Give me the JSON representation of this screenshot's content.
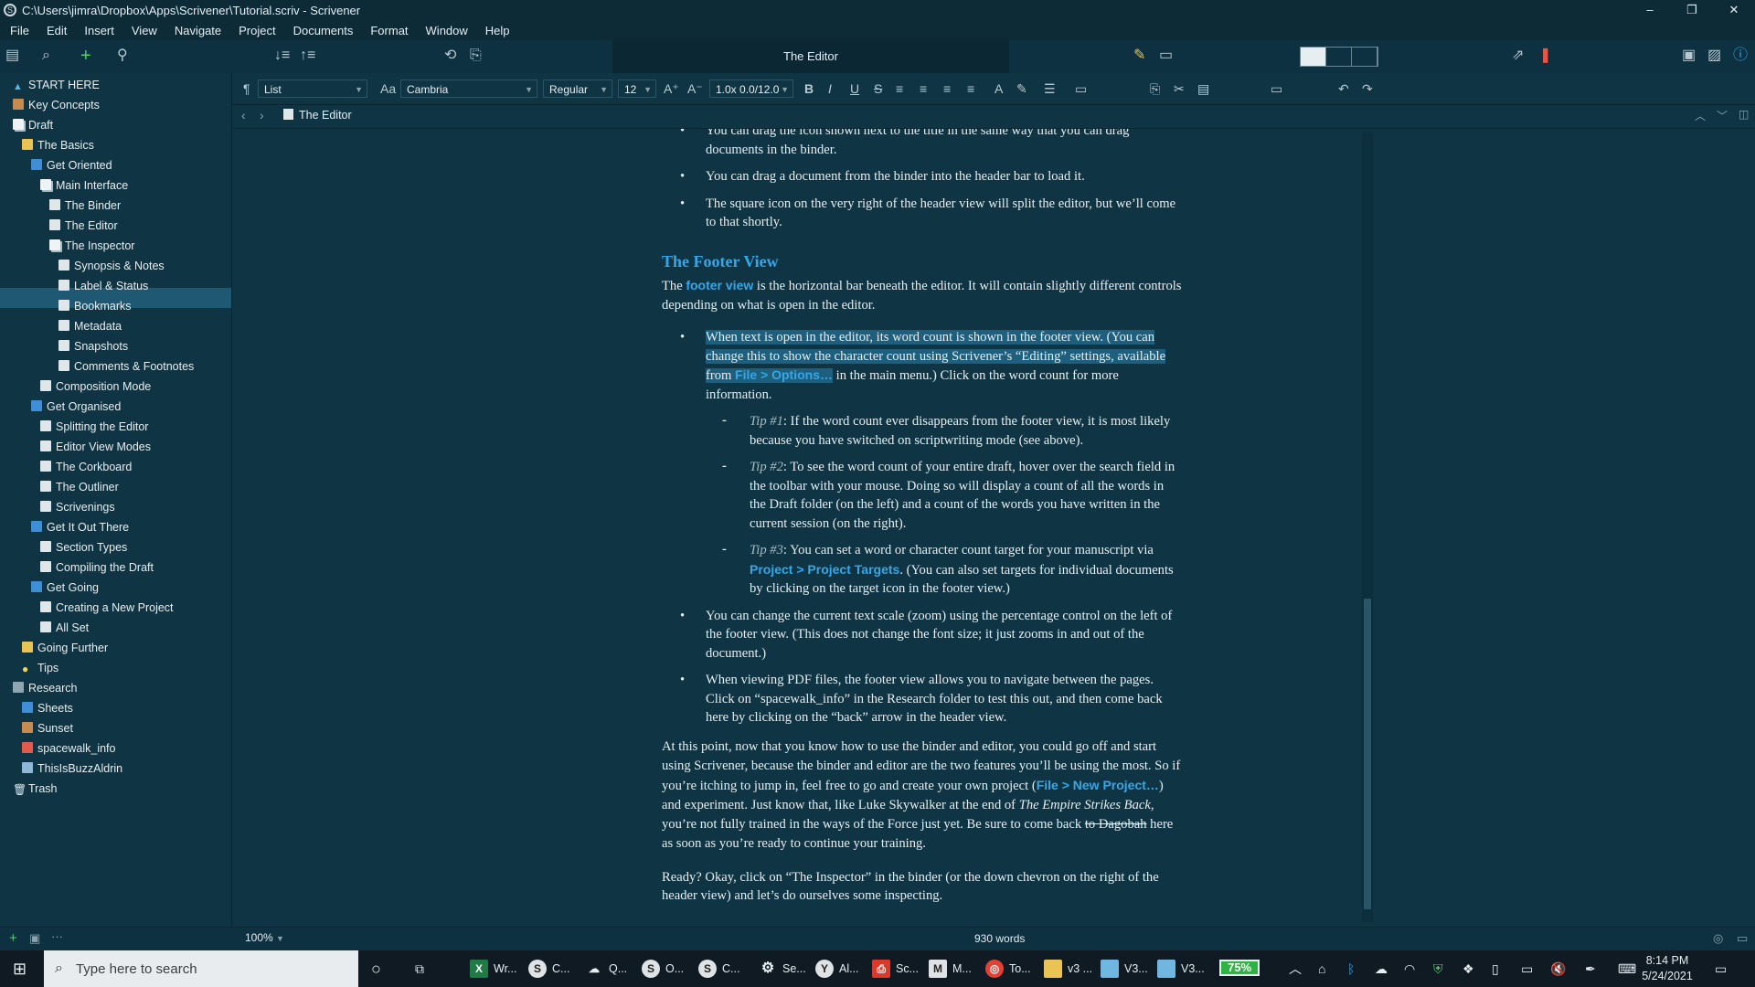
{
  "window": {
    "title": "C:\\Users\\jimra\\Dropbox\\Apps\\Scrivener\\Tutorial.scriv - Scrivener",
    "minimize": "–",
    "restore": "❐",
    "close": "✕"
  },
  "menu": [
    "File",
    "Edit",
    "Insert",
    "View",
    "Navigate",
    "Project",
    "Documents",
    "Format",
    "Window",
    "Help"
  ],
  "toolbar": {
    "title": "The Editor"
  },
  "binder": {
    "items": [
      "START HERE",
      "Key Concepts",
      "Draft",
      "The Basics",
      "Get Oriented",
      "Main Interface",
      "The Binder",
      "The Editor",
      "The Inspector",
      "Synopsis & Notes",
      "Label & Status",
      "Bookmarks",
      "Metadata",
      "Snapshots",
      "Comments & Footnotes",
      "Composition Mode",
      "Get Organised",
      "Splitting the Editor",
      "Editor View Modes",
      "The Corkboard",
      "The Outliner",
      "Scrivenings",
      "Get It Out There",
      "Section Types",
      "Compiling the Draft",
      "Get Going",
      "Creating a New Project",
      "All Set",
      "Going Further",
      "Tips",
      "Research",
      "Sheets",
      "Sunset",
      "spacewalk_info",
      "ThisIsBuzzAldrin",
      "Trash"
    ]
  },
  "format": {
    "style": "List",
    "font": "Cambria",
    "weight": "Regular",
    "size": "12",
    "spacing": "1.0x 0.0/12.0"
  },
  "header": {
    "doc": "The Editor"
  },
  "content": {
    "b0": "You can drag the icon shown next to the title in the same way that you can drag documents in the binder.",
    "b1": "You can drag a document from the binder into the header bar to load it.",
    "b2": "The square icon on the very right of the header view will split the editor, but we’ll come to that shortly.",
    "h": "The Footer View",
    "p1a": "The ",
    "p1link": "footer view",
    "p1b": " is the horizontal bar beneath the editor. It will contain slightly different controls depending on what is open in the editor.",
    "b3a": "When text is open in the editor, its word count is shown in the footer view. (You can change this to show the character count using Scrivener’s “Editing” settings, available from ",
    "b3link": "File > Options…",
    "b3b": " in the main menu.) Click on the word count for more information.",
    "t1label": "Tip #1",
    "t1": ": If the word count ever disappears from the footer view, it is most likely because you have switched on scriptwriting mode (see above).",
    "t2label": "Tip #2",
    "t2": ": To see the word count of your entire draft, hover over the search field in the toolbar with your mouse. Doing so will display a count of all the words in the Draft folder (on the left) and a count of the words you have written in the current session (on the right).",
    "t3label": "Tip #3",
    "t3a": ": You can set a word or character count target for your manuscript via ",
    "t3link": "Project > Project Targets",
    "t3b": ". (You can also set targets for individual documents by clicking on the target icon in the footer view.)",
    "b4": "You can change the current text scale (zoom) using the percentage control on the left of the footer view. (This does not change the font size; it just zooms in and out of the document.)",
    "b5": "When viewing PDF files, the footer view allows you to navigate between the pages. Click on “spacewalk_info” in the Research folder to test this out, and then come back here by clicking on the “back” arrow in the header view.",
    "p2a": "At this point, now that you know how to use the binder and editor, you could go off and start using Scrivener, because the binder and editor are the two features you’ll be using the most. So if you’re itching to jump in, feel free to go and create your own project (",
    "p2link": "File > New Project…",
    "p2b": ") and experiment. Just know that, like Luke Skywalker at the end of ",
    "p2it": "The Empire Strikes Back",
    "p2c": ", you’re not fully trained in the ways of the Force just yet. Be sure to come back ",
    "p2strike": "to Dagobah",
    "p2d": " here as soon as you’re ready to continue your training.",
    "p3": "Ready? Okay, click on “The Inspector” in the binder (or the down chevron on the right of the header view) and let’s do ourselves some inspecting."
  },
  "footer": {
    "zoom": "100%",
    "wordcount": "930 words"
  },
  "taskbar": {
    "search_placeholder": "Type here to search",
    "apps": [
      "Wr...",
      "C...",
      "Q...",
      "O...",
      "C...",
      "Se...",
      "Al...",
      "Sc...",
      "M...",
      "To...",
      "v3 ...",
      "V3...",
      "V3..."
    ],
    "battery": "75%",
    "time": "8:14 PM",
    "date": "5/24/2021"
  },
  "colors": {
    "background": "#0f3544",
    "link": "#35a7e8",
    "selection": "#1e5873",
    "battery": "#2fb344"
  }
}
